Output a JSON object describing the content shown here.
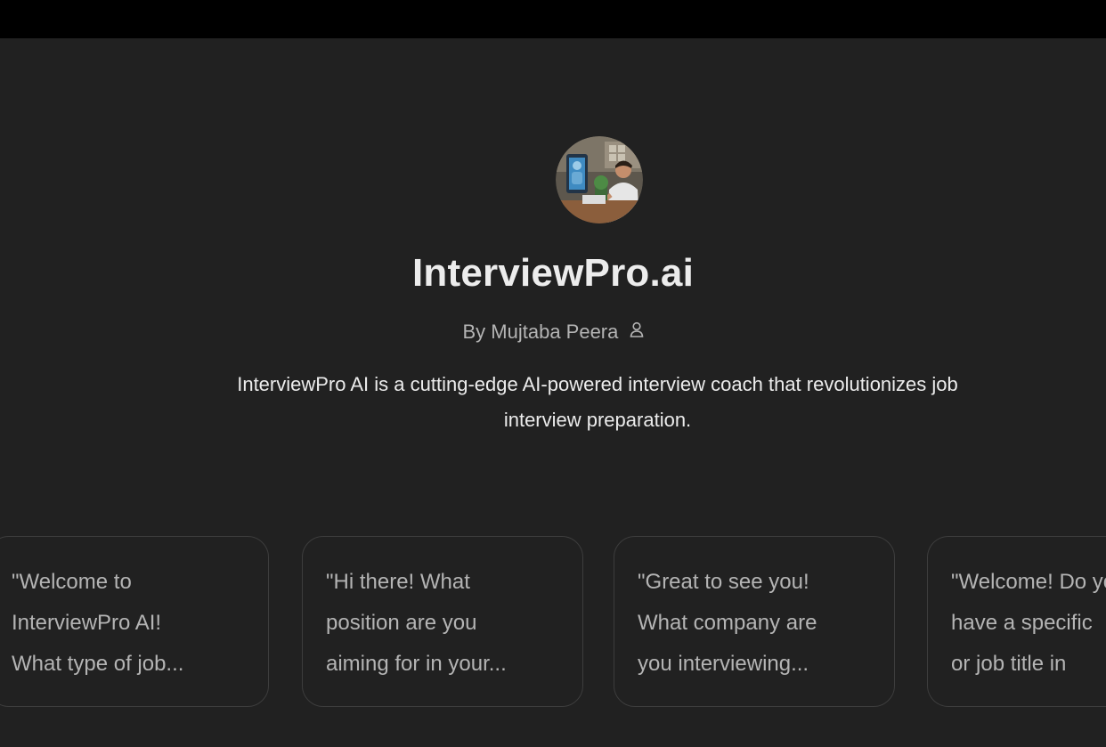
{
  "gpt": {
    "title": "InterviewPro.ai",
    "author": "By Mujtaba Peera",
    "description": "InterviewPro AI is a cutting-edge AI-powered interview coach that revolutionizes job interview preparation."
  },
  "icons": {
    "avatar": "gpt-avatar-image",
    "author": "person-icon"
  },
  "colors": {
    "background": "#212121",
    "topbar": "#000000",
    "title_text": "#ececec",
    "muted_text": "#b4b4b4",
    "card_border": "#3d3d3d"
  },
  "starters": [
    {
      "text": "\"Welcome to\nInterviewPro AI!\nWhat type of job..."
    },
    {
      "text": "\"Hi there! What\nposition are you\naiming for in your..."
    },
    {
      "text": "\"Great to see you!\nWhat company are\nyou interviewing..."
    },
    {
      "text": "\"Welcome! Do you\nhave a specific\nor job title in"
    }
  ]
}
